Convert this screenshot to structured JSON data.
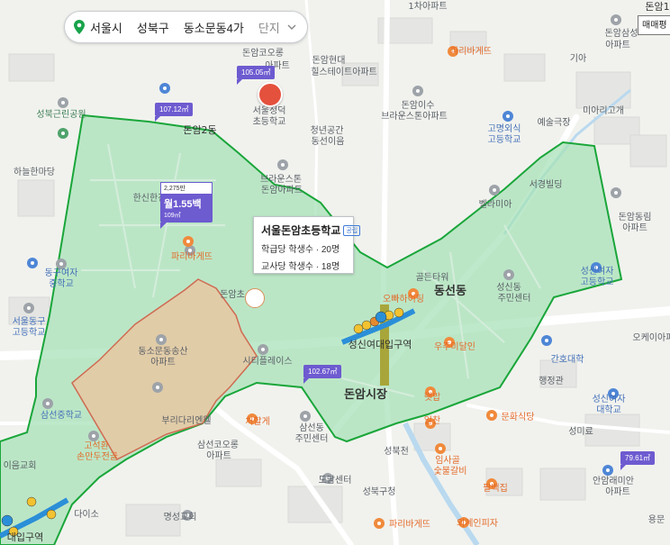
{
  "breadcrumb": {
    "city": "서울시",
    "district": "성북구",
    "dong": "동소문동4가",
    "type": "단지"
  },
  "corner_button": "매매평",
  "popup": {
    "title": "서울돈암초등학교",
    "badge": "공립",
    "row1": "학급당 학생수 · 20명",
    "row2": "교사당 학생수 · 18명"
  },
  "rent_tag": {
    "top": "2,275만",
    "main": "월1.55백",
    "sub": "109㎡"
  },
  "price_tags": [
    "105.05㎡",
    "107.12㎡",
    "102.67㎡",
    "79.61㎡"
  ],
  "labels": {
    "a1": "1차아파트",
    "a2": "돈암1",
    "a3": "돈암코오롱",
    "a4": "아파트",
    "a5": "돈암현대",
    "a6": "힐스테이트아파트",
    "a7": "파리바게뜨",
    "a8": "돈암삼성",
    "a9": "아파트",
    "a10": "기아",
    "b1": "성북근린공원",
    "b2": "서울정덕",
    "b3": "초등학교",
    "b4": "돈암이수",
    "b5": "브라운스톤아파트",
    "b6": "미아리고개",
    "b7": "예술극장",
    "b8": "고명외식",
    "b9": "고등학교",
    "b10": "돈암2동",
    "b11": "청년공간",
    "b12": "동선이음",
    "c1": "하늘한마당",
    "c2": "브라운스톤",
    "c3": "돈암아파트",
    "c4": "한신한진",
    "c5": "서경빌딩",
    "c6": "벨라미아",
    "c7": "돈암동림",
    "c8": "아파트",
    "d1": "동구여자",
    "d2": "중학교",
    "d3": "파리바게뜨",
    "d4": "돈암초",
    "d5": "골든타워",
    "d6": "오빠하이팅",
    "d7": "동선동",
    "d8": "성신여자",
    "d9": "고등학교",
    "d10": "성신동",
    "d11": "주민센터",
    "e1": "서울동구",
    "e2": "고등학교",
    "e3": "동소문동송산",
    "e4": "아파트",
    "e5": "시티플레이스",
    "e6": "성신여대입구역",
    "e7": "우주미달인",
    "e8": "간호대학",
    "f1": "돈암시장",
    "f2": "행정관",
    "f3": "성신여자",
    "f4": "대학교",
    "f5": "삼선중학교",
    "f6": "부리다리엔웰",
    "f7": "처할게",
    "f8": "삼선동",
    "f9": "주민센터",
    "f10": "일찬",
    "f11": "문화식당",
    "f12": "햇밥",
    "f13": "성미료",
    "g1": "고석환",
    "g2": "손만두전골",
    "g3": "이음교회",
    "g4": "삼선코오롱",
    "g5": "아파트",
    "g6": "성북천",
    "g7": "임사골",
    "g8": "숯불갈비",
    "g9": "도담센터",
    "g10": "다이소",
    "g11": "안암래미안",
    "g12": "아파트",
    "h1": "명성교회",
    "h2": "성북구청",
    "h3": "팔백집",
    "h4": "용문",
    "h5": "파리바게뜨",
    "h6": "외계인피자",
    "h7": "대입구역",
    "h8": "오케이아파트"
  },
  "colors": {
    "zone_fill": "#a6e0b6",
    "zone_stroke": "#1aa63a",
    "inner_fill": "#e6c8a6",
    "inner_stroke": "#d06a50",
    "subway": "#2b8fd8",
    "rail": "#a7a43a",
    "tag": "#6d5bd0"
  }
}
